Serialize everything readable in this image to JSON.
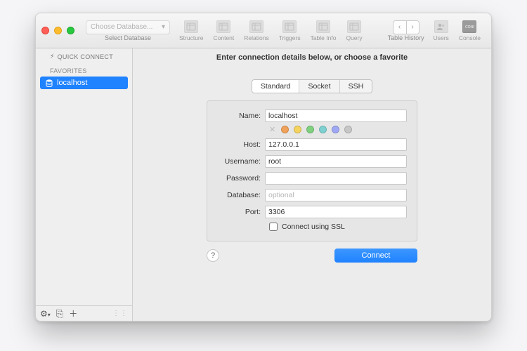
{
  "toolbar": {
    "db_select_label": "Choose Database...",
    "db_select_caption": "Select Database",
    "buttons": [
      {
        "id": "structure",
        "label": "Structure"
      },
      {
        "id": "content",
        "label": "Content"
      },
      {
        "id": "relations",
        "label": "Relations"
      },
      {
        "id": "triggers",
        "label": "Triggers"
      },
      {
        "id": "table-info",
        "label": "Table Info"
      },
      {
        "id": "query",
        "label": "Query"
      }
    ],
    "history_label": "Table History",
    "users_label": "Users",
    "console_label": "Console"
  },
  "sidebar": {
    "quick_connect_label": "QUICK CONNECT",
    "favorites_label": "FAVORITES",
    "items": [
      {
        "label": "localhost",
        "selected": true
      }
    ]
  },
  "main": {
    "title": "Enter connection details below, or choose a favorite",
    "tabs": [
      {
        "id": "standard",
        "label": "Standard",
        "active": true
      },
      {
        "id": "socket",
        "label": "Socket",
        "active": false
      },
      {
        "id": "ssh",
        "label": "SSH",
        "active": false
      }
    ],
    "form": {
      "name_label": "Name:",
      "name_value": "localhost",
      "host_label": "Host:",
      "host_value": "127.0.0.1",
      "username_label": "Username:",
      "username_value": "root",
      "password_label": "Password:",
      "password_value": "",
      "database_label": "Database:",
      "database_placeholder": "optional",
      "database_value": "",
      "port_label": "Port:",
      "port_value": "3306",
      "ssl_label": "Connect using SSL",
      "colors": [
        "#f0a25a",
        "#f4d35e",
        "#7fd17f",
        "#7fd1d1",
        "#9fa8f4",
        "#c7c7c7"
      ]
    },
    "help_label": "?",
    "connect_label": "Connect"
  }
}
